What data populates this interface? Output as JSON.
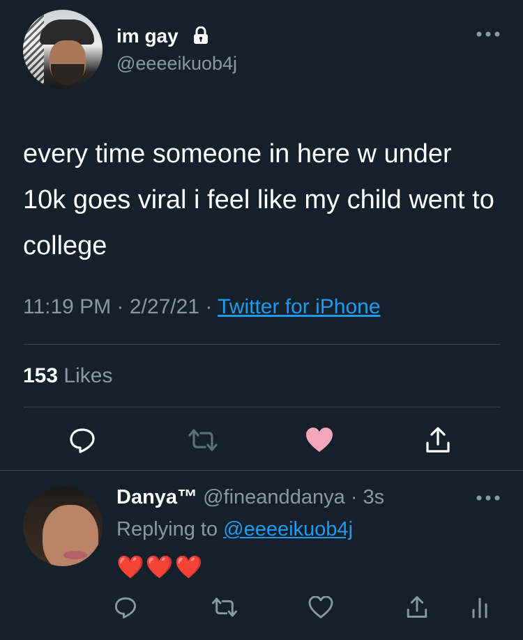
{
  "tweet": {
    "display_name": "im gay",
    "handle": "@eeeeikuob4j",
    "text": "every time someone in here w under 10k goes viral i feel like my child went to college",
    "time": "11:19 PM",
    "date": "2/27/21",
    "separator": "·",
    "source": "Twitter for iPhone",
    "likes_count": "153",
    "likes_label": "Likes",
    "liked": true,
    "icons": [
      "lock-icon",
      "more-icon",
      "reply-icon",
      "retweet-icon",
      "like-icon",
      "share-icon"
    ],
    "colors": {
      "like": "#f4a7b9",
      "link": "#1d9bf0",
      "muted": "#8899a6",
      "background": "#15202b"
    }
  },
  "reply": {
    "display_name": "Danya™",
    "handle": "@fineanddanya",
    "separator": "·",
    "time_ago": "3s",
    "replying_prefix": "Replying to",
    "replying_to": "@eeeeikuob4j",
    "text": "❤️❤️❤️",
    "icons": [
      "reply-icon",
      "retweet-icon",
      "like-icon",
      "share-icon",
      "analytics-icon",
      "more-icon"
    ]
  }
}
